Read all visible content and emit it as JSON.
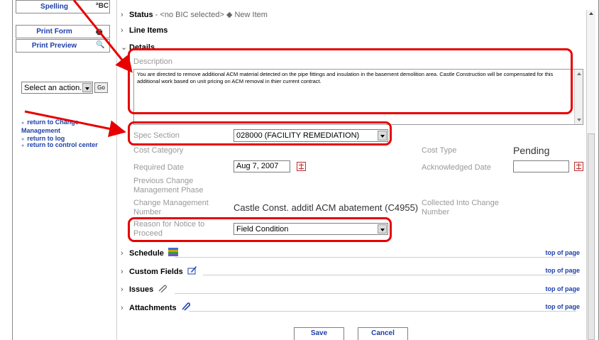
{
  "left_panel": {
    "tools": [
      {
        "label": "Spelling",
        "icon": "abc-icon",
        "icon_text": "ªBC"
      },
      {
        "label": "Print Form",
        "icon": "printer-icon",
        "icon_text": "🖶"
      },
      {
        "label": "Print Preview",
        "icon": "preview-icon",
        "icon_text": "🔍"
      }
    ],
    "action_select": "Select an action...",
    "go_label": "Go",
    "links": [
      "return to Change Management",
      "return to log",
      "return to control center"
    ]
  },
  "header": {
    "status_label": "Status",
    "status_text": " - <no BIC selected> ◆ New Item"
  },
  "sections": {
    "line_items": "Line Items",
    "details": "Details",
    "schedule": "Schedule",
    "custom_fields": "Custom Fields",
    "issues": "Issues",
    "attachments": "Attachments",
    "top_of_page": "top of page"
  },
  "form": {
    "description_label": "Description",
    "description_value": "You are directed to remove additional ACM material detected on the pipe fittings and insulation in the basement demolition area.  Castle Construction will be compensated for this additional work based on unit pricing on ACM removal in thier current contract.",
    "spec_section_label": "Spec Section",
    "spec_section_value": "028000 (FACILITY REMEDIATION)",
    "cost_category_label": "Cost Category",
    "cost_type_label": "Cost Type",
    "cost_type_value": "Pending",
    "required_date_label": "Required Date",
    "required_date_value": "Aug 7, 2007",
    "acknowledged_date_label": "Acknowledged Date",
    "acknowledged_date_value": "",
    "prev_phase_label": "Previous Change Management Phase",
    "cm_number_label": "Change Management Number",
    "cm_number_value": "Castle Const. additl ACM abatement (C4955)",
    "collected_into_label": "Collected Into Change Number",
    "reason_label": "Reason for Notice to Proceed",
    "reason_value": "Field Condition"
  },
  "buttons": {
    "save": "Save",
    "cancel": "Cancel"
  },
  "colors": {
    "highlight": "#e60000",
    "link": "#1d3fa8"
  }
}
